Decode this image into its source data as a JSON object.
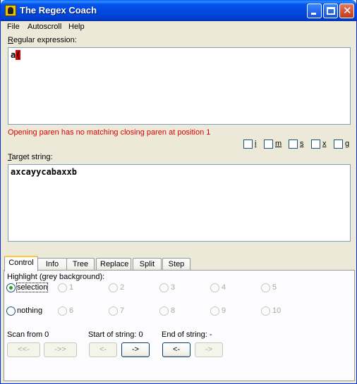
{
  "window": {
    "title": "The Regex Coach"
  },
  "menu": [
    "File",
    "Autoscroll",
    "Help"
  ],
  "regex": {
    "label_first": "R",
    "label_rest": "egular expression:",
    "value_normal": "a",
    "value_highlight": "(",
    "error": "Opening paren has no matching closing paren at position 1"
  },
  "flags": [
    "i",
    "m",
    "s",
    "x",
    "g"
  ],
  "target": {
    "label_first": "T",
    "label_rest": "arget string:",
    "value": "axcayycabaxxb"
  },
  "tabs": [
    {
      "label": "Control",
      "active": true
    },
    {
      "label": "Info",
      "active": false
    },
    {
      "label": "Tree",
      "active": false
    },
    {
      "label": "Replace",
      "active": false
    },
    {
      "label": "Split",
      "active": false
    },
    {
      "label": "Step",
      "active": false
    }
  ],
  "control": {
    "highlight_label": "Highlight (grey background):",
    "selection_label": "selection",
    "nothing_label": "nothing",
    "groups_row1": [
      "1",
      "2",
      "3",
      "4",
      "5"
    ],
    "groups_row2": [
      "6",
      "7",
      "8",
      "9",
      "10"
    ],
    "scan_label": "Scan from 0",
    "start_label": "Start of string: 0",
    "end_label": "End of string: -",
    "scan_prev": "<<-",
    "scan_next": "->>",
    "start_prev": "<-",
    "start_next": "->",
    "end_prev": "<-",
    "end_next": "->"
  }
}
